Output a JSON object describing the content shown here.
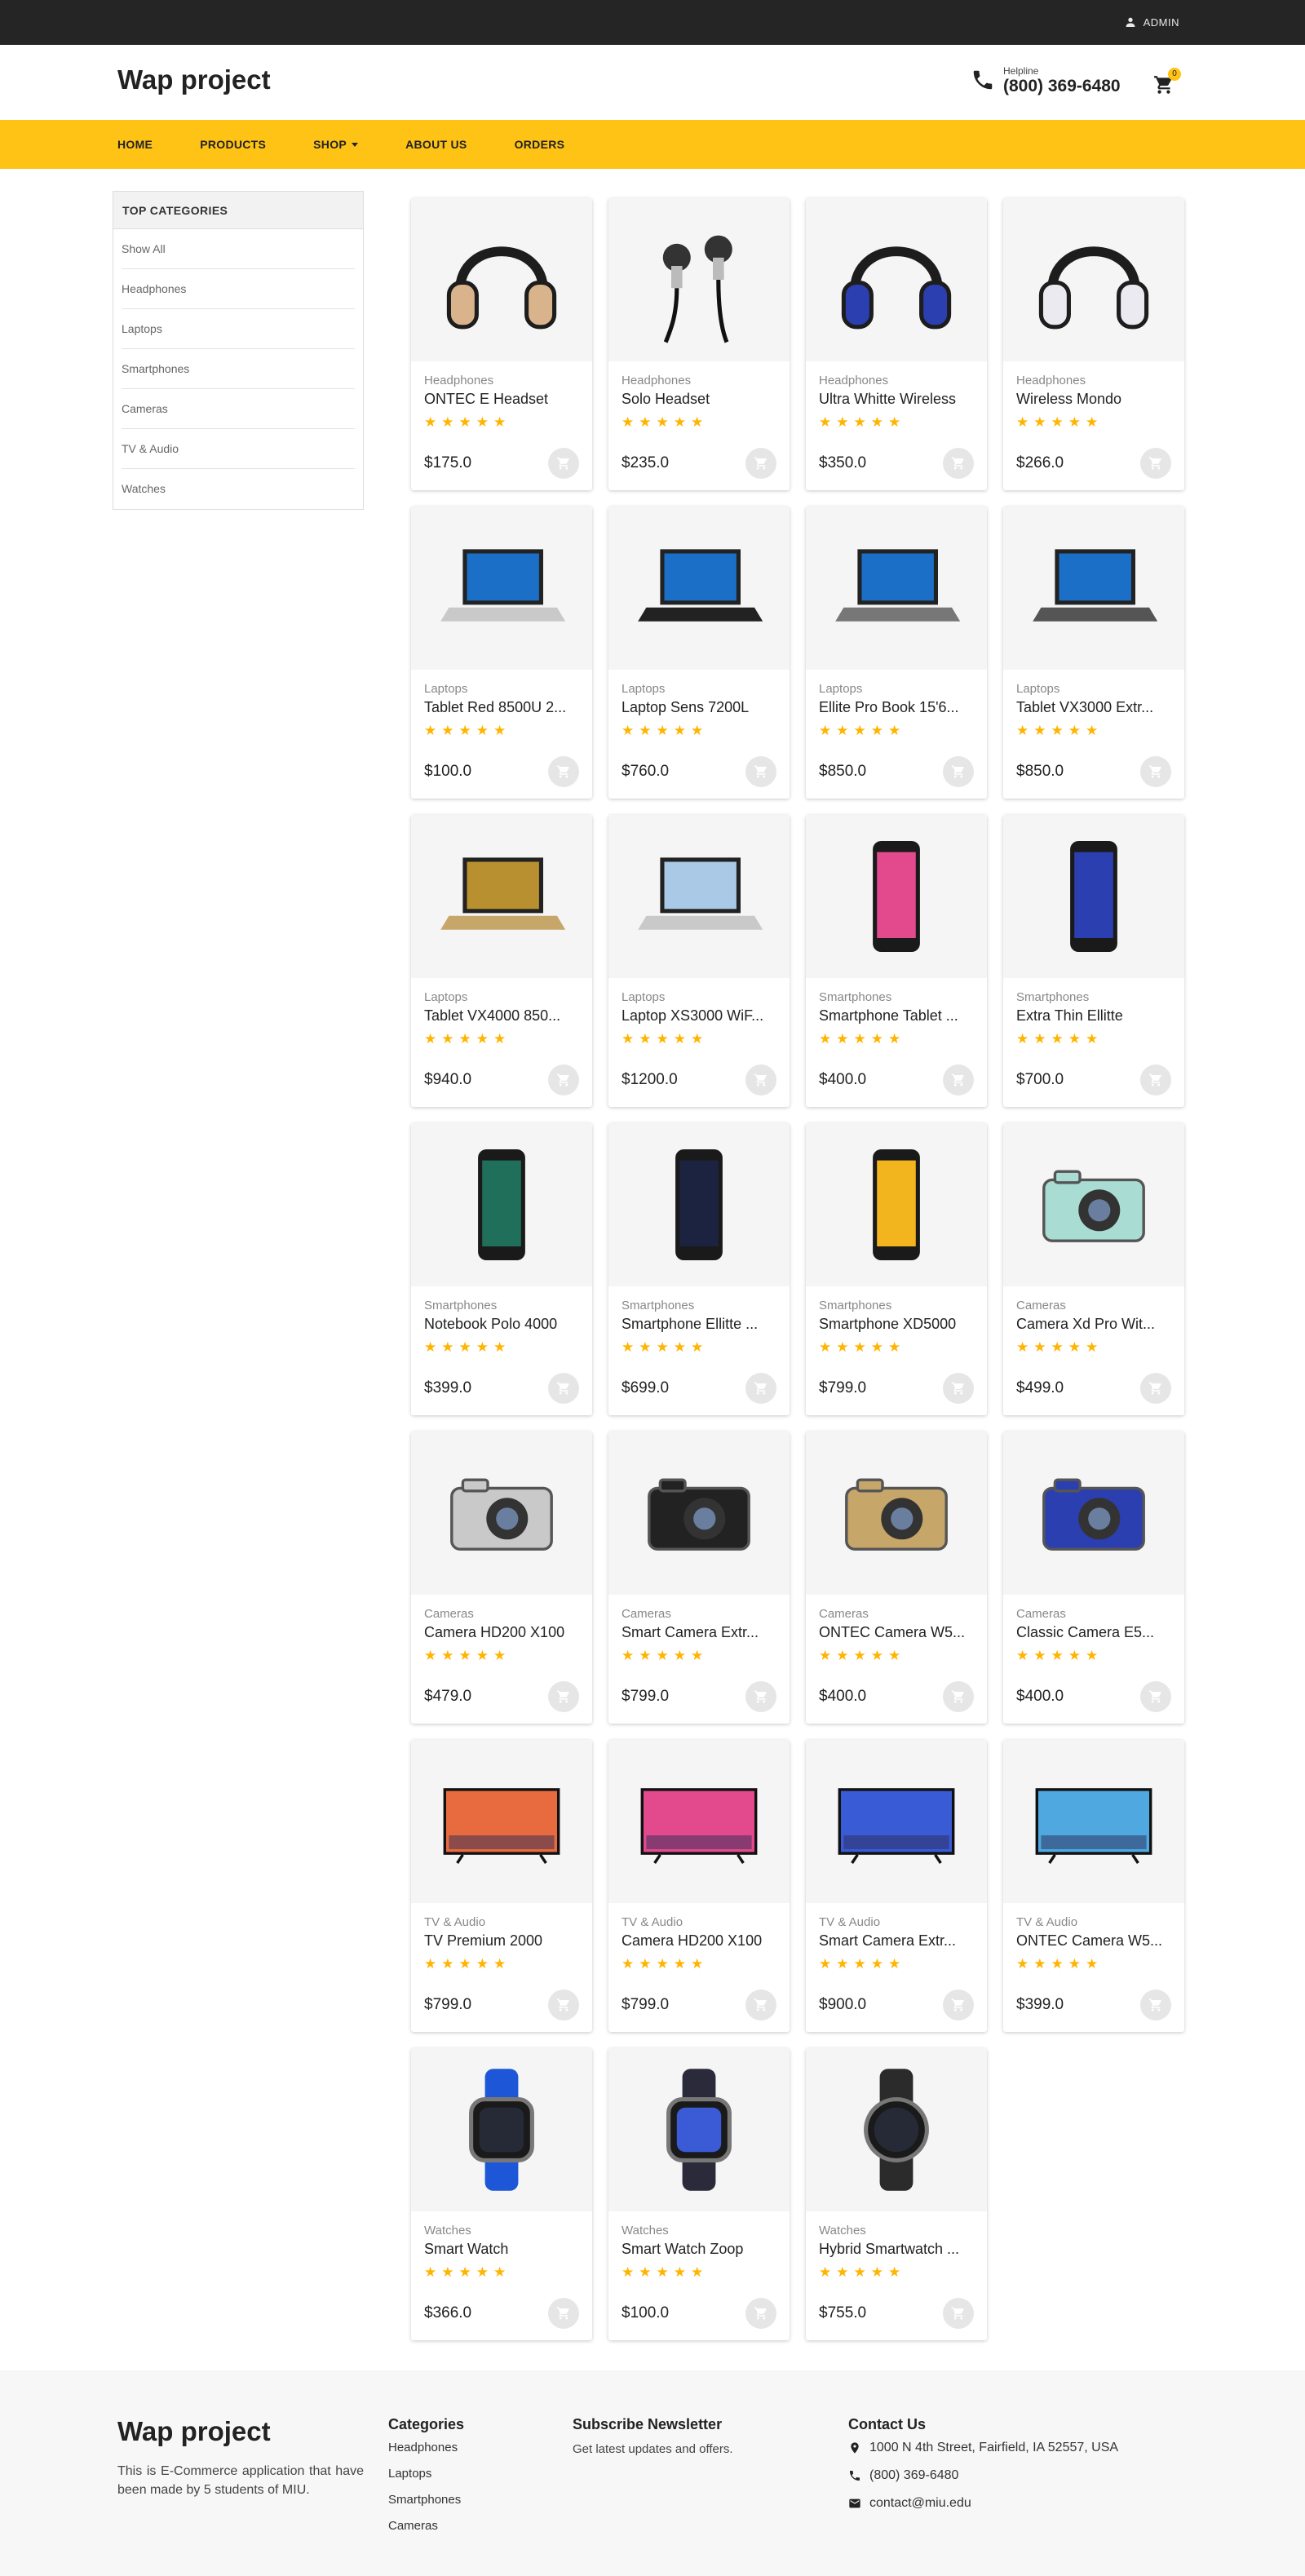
{
  "topbar": {
    "admin_label": "ADMIN"
  },
  "header": {
    "brand": "Wap project",
    "helpline_label": "Helpline",
    "helpline_number": "(800) 369-6480",
    "cart_count": "0"
  },
  "nav": {
    "items": [
      {
        "label": "HOME"
      },
      {
        "label": "PRODUCTS"
      },
      {
        "label": "SHOP"
      },
      {
        "label": "ABOUT US"
      },
      {
        "label": "ORDERS"
      }
    ]
  },
  "sidebar": {
    "title": "TOP CATEGORIES",
    "items": [
      {
        "label": "Show All"
      },
      {
        "label": "Headphones"
      },
      {
        "label": "Laptops"
      },
      {
        "label": "Smartphones"
      },
      {
        "label": "Cameras"
      },
      {
        "label": "TV & Audio"
      },
      {
        "label": "Watches"
      }
    ]
  },
  "rating_stars": "★★★★★",
  "products": [
    {
      "category": "Headphones",
      "name": "ONTEC E Headset",
      "price": "$175.0",
      "icon": "headphones-beige"
    },
    {
      "category": "Headphones",
      "name": "Solo Headset",
      "price": "$235.0",
      "icon": "earbuds"
    },
    {
      "category": "Headphones",
      "name": "Ultra Whitte Wireless",
      "price": "$350.0",
      "icon": "headphones-blue"
    },
    {
      "category": "Headphones",
      "name": "Wireless Mondo",
      "price": "$266.0",
      "icon": "headphones-white"
    },
    {
      "category": "Laptops",
      "name": "Tablet Red 8500U 2...",
      "price": "$100.0",
      "icon": "laptop-silver"
    },
    {
      "category": "Laptops",
      "name": "Laptop Sens 7200L",
      "price": "$760.0",
      "icon": "laptop-black"
    },
    {
      "category": "Laptops",
      "name": "Ellite Pro Book 15'6...",
      "price": "$850.0",
      "icon": "laptop-convertible"
    },
    {
      "category": "Laptops",
      "name": "Tablet VX3000 Extr...",
      "price": "$850.0",
      "icon": "laptop-grey"
    },
    {
      "category": "Laptops",
      "name": "Tablet VX4000 850...",
      "price": "$940.0",
      "icon": "laptop-gold"
    },
    {
      "category": "Laptops",
      "name": "Laptop XS3000 WiF...",
      "price": "$1200.0",
      "icon": "laptop-mountain"
    },
    {
      "category": "Smartphones",
      "name": "Smartphone Tablet ...",
      "price": "$400.0",
      "icon": "phone-colorful"
    },
    {
      "category": "Smartphones",
      "name": "Extra Thin Ellitte",
      "price": "$700.0",
      "icon": "phone-blue"
    },
    {
      "category": "Smartphones",
      "name": "Notebook Polo 4000",
      "price": "$399.0",
      "icon": "phone-green"
    },
    {
      "category": "Smartphones",
      "name": "Smartphone Ellitte ...",
      "price": "$699.0",
      "icon": "phone-dark"
    },
    {
      "category": "Smartphones",
      "name": "Smartphone XD5000",
      "price": "$799.0",
      "icon": "phone-yellow"
    },
    {
      "category": "Cameras",
      "name": "Camera Xd Pro Wit...",
      "price": "$499.0",
      "icon": "camera-mint"
    },
    {
      "category": "Cameras",
      "name": "Camera HD200 X100",
      "price": "$479.0",
      "icon": "camera-silver"
    },
    {
      "category": "Cameras",
      "name": "Smart Camera Extr...",
      "price": "$799.0",
      "icon": "camera-black"
    },
    {
      "category": "Cameras",
      "name": "ONTEC Camera W5...",
      "price": "$400.0",
      "icon": "camera-gold"
    },
    {
      "category": "Cameras",
      "name": "Classic Camera E5...",
      "price": "$400.0",
      "icon": "camera-blue"
    },
    {
      "category": "TV & Audio",
      "name": "TV Premium 2000",
      "price": "$799.0",
      "icon": "tv-sunset"
    },
    {
      "category": "TV & Audio",
      "name": "Camera HD200 X100",
      "price": "$799.0",
      "icon": "tv-colorful"
    },
    {
      "category": "TV & Audio",
      "name": "Smart Camera Extr...",
      "price": "$900.0",
      "icon": "tv-ocean"
    },
    {
      "category": "TV & Audio",
      "name": "ONTEC Camera W5...",
      "price": "$399.0",
      "icon": "tv-sky"
    },
    {
      "category": "Watches",
      "name": "Smart Watch",
      "price": "$366.0",
      "icon": "watch-kids"
    },
    {
      "category": "Watches",
      "name": "Smart Watch Zoop",
      "price": "$100.0",
      "icon": "watch-curved"
    },
    {
      "category": "Watches",
      "name": "Hybrid Smartwatch ...",
      "price": "$755.0",
      "icon": "watch-round"
    }
  ],
  "footer": {
    "brand": "Wap project",
    "description": "This is E-Commerce application that have been made by 5 students of MIU.",
    "categories_title": "Categories",
    "categories": [
      {
        "label": "Headphones"
      },
      {
        "label": "Laptops"
      },
      {
        "label": "Smartphones"
      },
      {
        "label": "Cameras"
      }
    ],
    "newsletter_title": "Subscribe Newsletter",
    "newsletter_text": "Get latest updates and offers.",
    "contact_title": "Contact Us",
    "address": "1000 N 4th Street, Fairfield, IA 52557, USA",
    "phone": "(800) 369-6480",
    "email": "contact@miu.edu"
  },
  "colors": {
    "accent": "#ffc316",
    "topbar": "#252525",
    "star": "#ffb400"
  }
}
